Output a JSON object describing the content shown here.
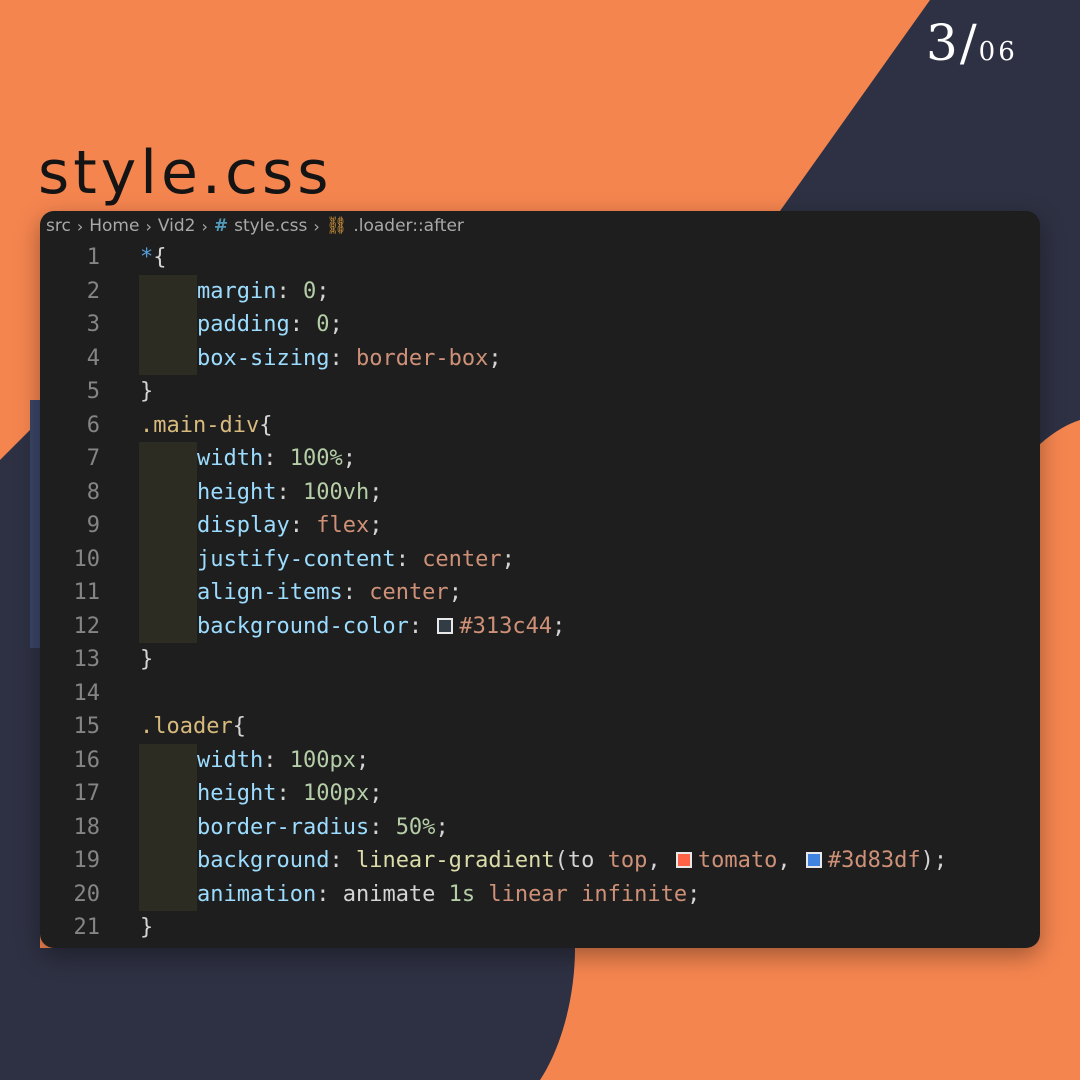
{
  "page_counter": {
    "current": "3",
    "separator": "/",
    "total": "06"
  },
  "title": "style.css",
  "colors": {
    "orange": "#f5854f",
    "navy": "#2e3143",
    "editor_bg": "#1e1e1e"
  },
  "breadcrumb": {
    "items": [
      "src",
      "Home",
      "Vid2",
      "style.css",
      ".loader::after"
    ],
    "file_icon": "hash-icon",
    "symbol_icon": "css-symbol-icon"
  },
  "code_lines": [
    {
      "number": "1",
      "tokens": [
        [
          "star",
          "*"
        ],
        [
          "pun",
          "{"
        ]
      ]
    },
    {
      "number": "2",
      "tokens": [
        [
          "prop",
          "margin"
        ],
        [
          "pun",
          ": "
        ],
        [
          "num",
          "0"
        ],
        [
          "pun",
          ";"
        ]
      ]
    },
    {
      "number": "3",
      "tokens": [
        [
          "prop",
          "padding"
        ],
        [
          "pun",
          ": "
        ],
        [
          "num",
          "0"
        ],
        [
          "pun",
          ";"
        ]
      ]
    },
    {
      "number": "4",
      "tokens": [
        [
          "prop",
          "box-sizing"
        ],
        [
          "pun",
          ": "
        ],
        [
          "val",
          "border-box"
        ],
        [
          "pun",
          ";"
        ]
      ]
    },
    {
      "number": "5",
      "tokens": [
        [
          "pun",
          "}"
        ]
      ]
    },
    {
      "number": "6",
      "tokens": [
        [
          "sel",
          ".main-div"
        ],
        [
          "pun",
          "{"
        ]
      ]
    },
    {
      "number": "7",
      "tokens": [
        [
          "prop",
          "width"
        ],
        [
          "pun",
          ": "
        ],
        [
          "num",
          "100%"
        ],
        [
          "pun",
          ";"
        ]
      ]
    },
    {
      "number": "8",
      "tokens": [
        [
          "prop",
          "height"
        ],
        [
          "pun",
          ": "
        ],
        [
          "num",
          "100vh"
        ],
        [
          "pun",
          ";"
        ]
      ]
    },
    {
      "number": "9",
      "tokens": [
        [
          "prop",
          "display"
        ],
        [
          "pun",
          ": "
        ],
        [
          "val",
          "flex"
        ],
        [
          "pun",
          ";"
        ]
      ]
    },
    {
      "number": "10",
      "tokens": [
        [
          "prop",
          "justify-content"
        ],
        [
          "pun",
          ": "
        ],
        [
          "val",
          "center"
        ],
        [
          "pun",
          ";"
        ]
      ]
    },
    {
      "number": "11",
      "tokens": [
        [
          "prop",
          "align-items"
        ],
        [
          "pun",
          ": "
        ],
        [
          "val",
          "center"
        ],
        [
          "pun",
          ";"
        ]
      ]
    },
    {
      "number": "12",
      "tokens": [
        [
          "prop",
          "background-color"
        ],
        [
          "pun",
          ": "
        ],
        [
          "swatch",
          "#313c44"
        ],
        [
          "val",
          "#313c44"
        ],
        [
          "pun",
          ";"
        ]
      ]
    },
    {
      "number": "13",
      "tokens": [
        [
          "pun",
          "}"
        ]
      ]
    },
    {
      "number": "14",
      "tokens": []
    },
    {
      "number": "15",
      "tokens": [
        [
          "sel",
          ".loader"
        ],
        [
          "pun",
          "{"
        ]
      ]
    },
    {
      "number": "16",
      "tokens": [
        [
          "prop",
          "width"
        ],
        [
          "pun",
          ": "
        ],
        [
          "num",
          "100px"
        ],
        [
          "pun",
          ";"
        ]
      ]
    },
    {
      "number": "17",
      "tokens": [
        [
          "prop",
          "height"
        ],
        [
          "pun",
          ": "
        ],
        [
          "num",
          "100px"
        ],
        [
          "pun",
          ";"
        ]
      ]
    },
    {
      "number": "18",
      "tokens": [
        [
          "prop",
          "border-radius"
        ],
        [
          "pun",
          ": "
        ],
        [
          "num",
          "50%"
        ],
        [
          "pun",
          ";"
        ]
      ]
    },
    {
      "number": "19",
      "tokens": [
        [
          "prop",
          "background"
        ],
        [
          "pun",
          ": "
        ],
        [
          "fn",
          "linear-gradient"
        ],
        [
          "pun",
          "(to "
        ],
        [
          "val",
          "top"
        ],
        [
          "pun",
          ", "
        ],
        [
          "swatch",
          "tomato"
        ],
        [
          "val",
          "tomato"
        ],
        [
          "pun",
          ", "
        ],
        [
          "swatch",
          "#3d83df"
        ],
        [
          "val",
          "#3d83df"
        ],
        [
          "pun",
          ");"
        ]
      ]
    },
    {
      "number": "20",
      "tokens": [
        [
          "prop",
          "animation"
        ],
        [
          "pun",
          ": animate "
        ],
        [
          "num",
          "1s"
        ],
        [
          "pun",
          " "
        ],
        [
          "val",
          "linear"
        ],
        [
          "pun",
          " "
        ],
        [
          "val",
          "infinite"
        ],
        [
          "pun",
          ";"
        ]
      ]
    },
    {
      "number": "21",
      "tokens": [
        [
          "pun",
          "}"
        ]
      ]
    }
  ],
  "indented_lines": [
    "2",
    "3",
    "4",
    "7",
    "8",
    "9",
    "10",
    "11",
    "12",
    "16",
    "17",
    "18",
    "19",
    "20"
  ]
}
